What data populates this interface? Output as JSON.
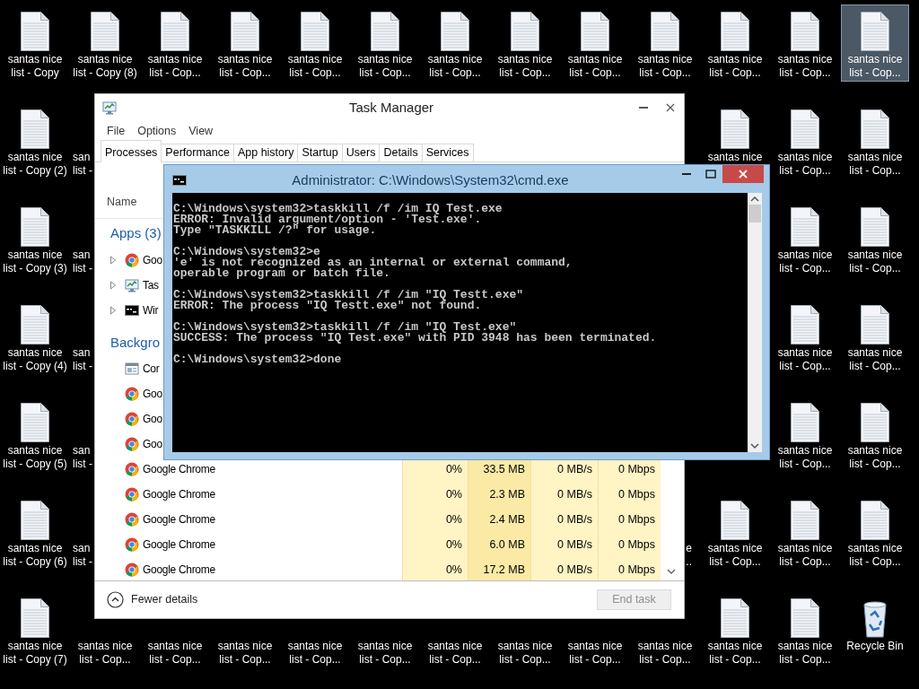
{
  "desktop": {
    "icon_columns": [
      [
        {
          "kind": "file",
          "selected": false,
          "lines": [
            "santas nice",
            "list - Copy"
          ]
        },
        {
          "kind": "file",
          "selected": false,
          "lines": [
            "santas nice",
            "list - Copy (2)"
          ]
        },
        {
          "kind": "file",
          "selected": false,
          "lines": [
            "santas nice",
            "list - Copy (3)"
          ]
        },
        {
          "kind": "file",
          "selected": false,
          "lines": [
            "santas nice",
            "list - Copy (4)"
          ]
        },
        {
          "kind": "file",
          "selected": false,
          "lines": [
            "santas nice",
            "list - Copy (5)"
          ]
        },
        {
          "kind": "file",
          "selected": false,
          "lines": [
            "santas nice",
            "list - Copy (6)"
          ]
        },
        {
          "kind": "file",
          "selected": false,
          "lines": [
            "santas nice",
            "list - Copy (7)"
          ]
        }
      ],
      [
        {
          "kind": "file",
          "selected": false,
          "lines": [
            "santas nice",
            "list - Copy (8)"
          ]
        },
        {
          "kind": "label-left",
          "selected": false,
          "lines": [
            "san",
            "list -"
          ]
        },
        {
          "kind": "label-left",
          "selected": false,
          "lines": [
            "san",
            "list -"
          ]
        },
        {
          "kind": "label-left",
          "selected": false,
          "lines": [
            "san",
            "list -"
          ]
        },
        {
          "kind": "label-left",
          "selected": false,
          "lines": [
            "san",
            "list -"
          ]
        },
        {
          "kind": "label-left",
          "selected": false,
          "lines": [
            "san",
            "list -"
          ]
        },
        {
          "kind": "label",
          "selected": false,
          "lines": [
            "santas nice",
            "list - Cop..."
          ]
        }
      ],
      [
        {
          "kind": "file",
          "selected": false,
          "lines": [
            "santas nice",
            "list - Cop..."
          ]
        },
        null,
        null,
        null,
        null,
        null,
        {
          "kind": "label",
          "selected": false,
          "lines": [
            "santas nice",
            "list - Cop..."
          ]
        }
      ],
      [
        {
          "kind": "file",
          "selected": false,
          "lines": [
            "santas nice",
            "list - Cop..."
          ]
        },
        null,
        null,
        null,
        null,
        null,
        {
          "kind": "label",
          "selected": false,
          "lines": [
            "santas nice",
            "list - Cop..."
          ]
        }
      ],
      [
        {
          "kind": "file",
          "selected": false,
          "lines": [
            "santas nice",
            "list - Cop..."
          ]
        },
        null,
        null,
        null,
        null,
        null,
        {
          "kind": "label",
          "selected": false,
          "lines": [
            "santas nice",
            "list - Cop..."
          ]
        }
      ],
      [
        {
          "kind": "file",
          "selected": false,
          "lines": [
            "santas nice",
            "list - Cop..."
          ]
        },
        null,
        null,
        null,
        null,
        null,
        {
          "kind": "label",
          "selected": false,
          "lines": [
            "santas nice",
            "list - Cop..."
          ]
        }
      ],
      [
        {
          "kind": "file",
          "selected": false,
          "lines": [
            "santas nice",
            "list - Cop..."
          ]
        },
        null,
        null,
        null,
        null,
        null,
        {
          "kind": "label",
          "selected": false,
          "lines": [
            "santas nice",
            "list - Cop..."
          ]
        }
      ],
      [
        {
          "kind": "file",
          "selected": false,
          "lines": [
            "santas nice",
            "list - Cop..."
          ]
        },
        null,
        null,
        null,
        null,
        null,
        {
          "kind": "label",
          "selected": false,
          "lines": [
            "santas nice",
            "list - Cop..."
          ]
        }
      ],
      [
        {
          "kind": "file",
          "selected": false,
          "lines": [
            "santas nice",
            "list - Cop..."
          ]
        },
        null,
        null,
        null,
        null,
        null,
        {
          "kind": "label",
          "selected": false,
          "lines": [
            "santas nice",
            "list - Cop..."
          ]
        }
      ],
      [
        {
          "kind": "file",
          "selected": false,
          "lines": [
            "santas nice",
            "list - Cop..."
          ]
        },
        null,
        null,
        null,
        null,
        {
          "kind": "label-right",
          "selected": false,
          "lines": [
            "e",
            ".."
          ]
        },
        {
          "kind": "label",
          "selected": false,
          "lines": [
            "santas nice",
            "list - Cop..."
          ]
        }
      ],
      [
        {
          "kind": "file",
          "selected": false,
          "lines": [
            "santas nice",
            "list - Cop..."
          ]
        },
        {
          "kind": "file",
          "selected": false,
          "lines": [
            "santas nice"
          ]
        },
        null,
        null,
        null,
        {
          "kind": "file",
          "selected": false,
          "lines": [
            "santas nice",
            "list - Cop..."
          ]
        },
        {
          "kind": "file",
          "selected": false,
          "lines": [
            "santas nice",
            "list - Cop..."
          ]
        }
      ],
      [
        {
          "kind": "file",
          "selected": false,
          "lines": [
            "santas nice",
            "list - Cop..."
          ]
        },
        {
          "kind": "file",
          "selected": false,
          "lines": [
            "santas nice",
            "list - Cop..."
          ]
        },
        {
          "kind": "file",
          "selected": false,
          "lines": [
            "santas nice",
            "list - Cop..."
          ]
        },
        {
          "kind": "file",
          "selected": false,
          "lines": [
            "santas nice",
            "list - Cop..."
          ]
        },
        {
          "kind": "file",
          "selected": false,
          "lines": [
            "santas nice",
            "list - Cop..."
          ]
        },
        {
          "kind": "file",
          "selected": false,
          "lines": [
            "santas nice",
            "list - Cop..."
          ]
        },
        {
          "kind": "file",
          "selected": false,
          "lines": [
            "santas nice",
            "list - Cop..."
          ]
        }
      ],
      [
        {
          "kind": "file",
          "selected": true,
          "lines": [
            "santas nice",
            "list - Cop..."
          ]
        },
        {
          "kind": "file",
          "selected": false,
          "lines": [
            "santas nice",
            "list - Cop..."
          ]
        },
        {
          "kind": "file",
          "selected": false,
          "lines": [
            "santas nice",
            "list - Cop..."
          ]
        },
        {
          "kind": "file",
          "selected": false,
          "lines": [
            "santas nice",
            "list - Cop..."
          ]
        },
        {
          "kind": "file",
          "selected": false,
          "lines": [
            "santas nice",
            "list - Cop..."
          ]
        },
        {
          "kind": "file",
          "selected": false,
          "lines": [
            "santas nice",
            "list - Cop..."
          ]
        },
        {
          "kind": "recycle-bin",
          "selected": false,
          "lines": [
            "Recycle Bin"
          ]
        }
      ]
    ]
  },
  "task_manager": {
    "title": "Task Manager",
    "menu": [
      "File",
      "Options",
      "View"
    ],
    "tabs": [
      {
        "label": "Processes",
        "selected": true
      },
      {
        "label": "Performance",
        "selected": false
      },
      {
        "label": "App history",
        "selected": false
      },
      {
        "label": "Startup",
        "selected": false
      },
      {
        "label": "Users",
        "selected": false
      },
      {
        "label": "Details",
        "selected": false
      },
      {
        "label": "Services",
        "selected": false
      }
    ],
    "column_header": "Name",
    "groups": [
      {
        "title": "Apps (3)",
        "rows": [
          {
            "kind": "chrome",
            "name": "Goo",
            "expanded": false
          },
          {
            "kind": "task-manager",
            "name": "Tas",
            "expanded": false
          },
          {
            "kind": "console",
            "name": "Wir",
            "expanded": false
          }
        ]
      },
      {
        "title": "Backgro",
        "rows": [
          {
            "kind": "service",
            "name": "Cor"
          },
          {
            "kind": "chrome",
            "name": "Goo"
          },
          {
            "kind": "chrome",
            "name": "Goo"
          },
          {
            "kind": "chrome",
            "name": "Goo"
          },
          {
            "kind": "chrome",
            "name": "Google Chrome",
            "values": [
              "0%",
              "33.5 MB",
              "0 MB/s",
              "0 Mbps"
            ]
          },
          {
            "kind": "chrome",
            "name": "Google Chrome",
            "values": [
              "0%",
              "2.3 MB",
              "0 MB/s",
              "0 Mbps"
            ]
          },
          {
            "kind": "chrome",
            "name": "Google Chrome",
            "values": [
              "0%",
              "2.4 MB",
              "0 MB/s",
              "0 Mbps"
            ]
          },
          {
            "kind": "chrome",
            "name": "Google Chrome",
            "values": [
              "0%",
              "6.0 MB",
              "0 MB/s",
              "0 Mbps"
            ]
          },
          {
            "kind": "chrome",
            "name": "Google Chrome",
            "values": [
              "0%",
              "17.2 MB",
              "0 MB/s",
              "0 Mbps"
            ]
          }
        ]
      }
    ],
    "footer": {
      "details_toggle": "Fewer details",
      "end_task": {
        "label": "End task",
        "disabled": true
      }
    }
  },
  "console_window": {
    "title": "Administrator: C:\\Windows\\System32\\cmd.exe",
    "blocks": [
      [
        "C:\\Windows\\system32>taskkill /f /im IQ Test.exe",
        "ERROR: Invalid argument/option - 'Test.exe'.",
        "Type \"TASKKILL /?\" for usage."
      ],
      [
        "C:\\Windows\\system32>e",
        "'e' is not recognized as an internal or external command,",
        "operable program or batch file."
      ],
      [
        "C:\\Windows\\system32>taskkill /f /im \"IQ Testt.exe\"",
        "ERROR: The process \"IQ Testt.exe\" not found."
      ],
      [
        "C:\\Windows\\system32>taskkill /f /im \"IQ Test.exe\"",
        "SUCCESS: The process \"IQ Test.exe\" with PID 3948 has been terminated."
      ],
      [
        "C:\\Windows\\system32>done"
      ]
    ]
  }
}
